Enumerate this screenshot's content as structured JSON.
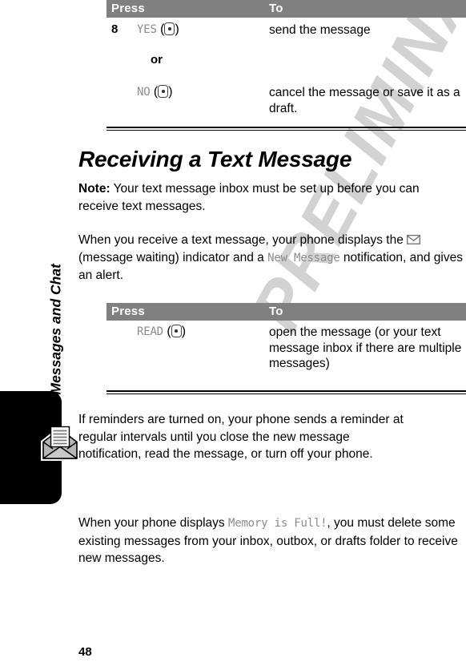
{
  "page": {
    "number": "48",
    "watermark": "PRELIMINARY",
    "sidebar_title": "Messages and Chat",
    "tab_icon": "open-envelope-icon"
  },
  "table_one": {
    "headers": {
      "press": "Press",
      "to": "To"
    },
    "rows": [
      {
        "step": "8",
        "key_label": "YES",
        "key_glyph": "softkey-icon",
        "action": "send the message"
      },
      {
        "separator": "or"
      },
      {
        "step": "",
        "key_label": "NO",
        "key_glyph": "softkey-icon",
        "action": "cancel the message or save it as a draft."
      }
    ]
  },
  "section": {
    "heading": "Receiving a Text Message",
    "note_label": "Note:",
    "note_text": "Your text message inbox must be set up before you can receive text messages.",
    "paragraph_2_part1": "When you receive a text message, your phone displays the",
    "paragraph_2_icon": "envelope-icon",
    "paragraph_2_part2": "(message waiting) indicator and a",
    "paragraph_2_display": "New Message",
    "paragraph_2_part3": "notification, and gives an alert."
  },
  "table_two": {
    "headers": {
      "press": "Press",
      "to": "To"
    },
    "rows": [
      {
        "key_label": "READ",
        "key_glyph": "softkey-icon",
        "action": "open the message (or your text message inbox if there are multiple messages)"
      }
    ]
  },
  "closing": {
    "paragraph_3": "If reminders are turned on, your phone sends a reminder at regular intervals until you close the new message notification, read the message, or turn off your phone.",
    "paragraph_4_part1": "When your phone displays",
    "paragraph_4_display": "Memory is Full!",
    "paragraph_4_part2": ", you must delete some existing messages from your inbox, outbox, or drafts folder to receive new messages."
  },
  "colors": {
    "table_header_bg": "#808080",
    "display_text": "#8c8c8c",
    "watermark": "#d2d2d2",
    "text": "#000000"
  }
}
